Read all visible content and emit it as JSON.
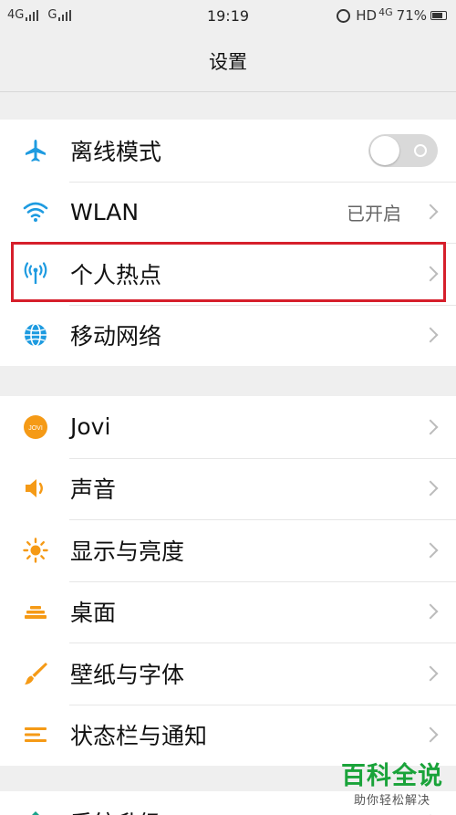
{
  "status_bar": {
    "left_network_1": "4G",
    "left_network_2": "G",
    "time": "19:19",
    "hd": "HD",
    "net_right": "4G",
    "battery": "71%"
  },
  "header": {
    "title": "设置"
  },
  "groups": [
    {
      "items": [
        {
          "label": "离线模式",
          "icon": "airplane-icon",
          "control": "toggle",
          "toggle_on": false
        },
        {
          "label": "WLAN",
          "icon": "wifi-icon",
          "value": "已开启"
        },
        {
          "label": "个人热点",
          "icon": "hotspot-icon",
          "highlighted": true
        },
        {
          "label": "移动网络",
          "icon": "globe-icon"
        }
      ]
    },
    {
      "items": [
        {
          "label": "Jovi",
          "icon": "jovi-icon",
          "icon_text": "JOVI"
        },
        {
          "label": "声音",
          "icon": "speaker-icon"
        },
        {
          "label": "显示与亮度",
          "icon": "brightness-icon"
        },
        {
          "label": "桌面",
          "icon": "desktop-icon"
        },
        {
          "label": "壁纸与字体",
          "icon": "brush-icon"
        },
        {
          "label": "状态栏与通知",
          "icon": "statusbar-icon"
        }
      ]
    },
    {
      "items": [
        {
          "label": "系统升级",
          "icon": "upgrade-icon"
        }
      ]
    }
  ],
  "watermark": {
    "main": "百科全说",
    "sub": "助你轻松解决"
  },
  "colors": {
    "blue_icon": "#1e9be0",
    "orange_icon": "#f59a16",
    "highlight_border": "#d61f2b",
    "watermark_green": "#1aa33a"
  }
}
